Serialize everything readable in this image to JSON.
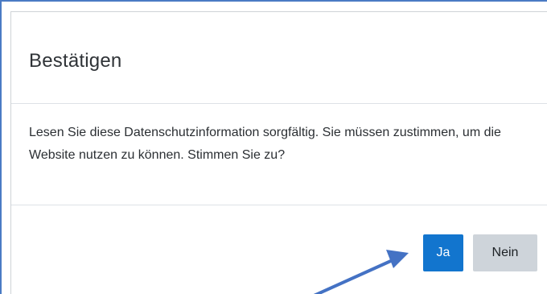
{
  "dialog": {
    "title": "Bestätigen",
    "message": "Lesen Sie diese Datenschutzinformation sorgfältig. Sie müssen zustimmen, um die Website nutzen zu können. Stimmen Sie zu?",
    "buttons": {
      "yes_label": "Ja",
      "no_label": "Nein"
    }
  },
  "colors": {
    "primary_button": "#1275ce",
    "secondary_button": "#ced4da",
    "annotation_arrow": "#4472c4"
  },
  "annotation": {
    "icon": "arrow-icon",
    "points_to": "yes-button"
  }
}
